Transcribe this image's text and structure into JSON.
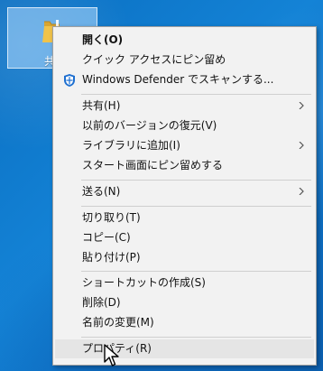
{
  "desktop": {
    "folder_label": "共"
  },
  "context_menu": {
    "items": [
      {
        "label": "開く(O)",
        "icon": "",
        "has_submenu": false
      },
      {
        "label": "クイック アクセスにピン留め",
        "icon": "",
        "has_submenu": false
      },
      {
        "label": "Windows Defender でスキャンする...",
        "icon": "windows-defender-shield",
        "has_submenu": false
      },
      {
        "label": "共有(H)",
        "icon": "",
        "has_submenu": true
      },
      {
        "label": "以前のバージョンの復元(V)",
        "icon": "",
        "has_submenu": false
      },
      {
        "label": "ライブラリに追加(I)",
        "icon": "",
        "has_submenu": true
      },
      {
        "label": "スタート画面にピン留めする",
        "icon": "",
        "has_submenu": false
      },
      {
        "label": "送る(N)",
        "icon": "",
        "has_submenu": true
      },
      {
        "label": "切り取り(T)",
        "icon": "",
        "has_submenu": false
      },
      {
        "label": "コピー(C)",
        "icon": "",
        "has_submenu": false
      },
      {
        "label": "貼り付け(P)",
        "icon": "",
        "has_submenu": false
      },
      {
        "label": "ショートカットの作成(S)",
        "icon": "",
        "has_submenu": false
      },
      {
        "label": "削除(D)",
        "icon": "",
        "has_submenu": false
      },
      {
        "label": "名前の変更(M)",
        "icon": "",
        "has_submenu": false
      },
      {
        "label": "プロパティ(R)",
        "icon": "",
        "has_submenu": false
      }
    ]
  },
  "colors": {
    "desktop_blue": "#0a6fc2",
    "menu_background": "#f2f2f2",
    "menu_highlight": "#e5e5e5",
    "defender_blue": "#1d6fd0"
  }
}
